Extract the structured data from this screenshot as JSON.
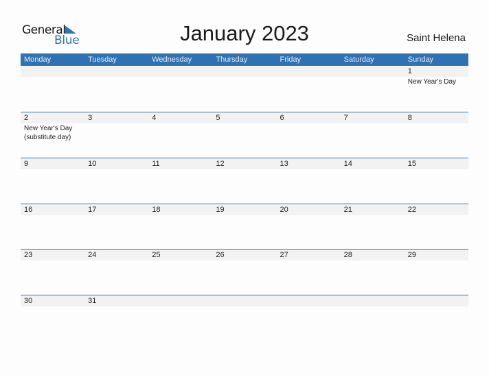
{
  "logo": {
    "line1": "General",
    "line2": "Blue"
  },
  "title": "January 2023",
  "region": "Saint Helena",
  "colors": {
    "accent": "#2e72b3",
    "date_strip": "#f2f2f2",
    "logo_blue": "#2a76c0"
  },
  "weekdays": [
    "Monday",
    "Tuesday",
    "Wednesday",
    "Thursday",
    "Friday",
    "Saturday",
    "Sunday"
  ],
  "weeks": [
    {
      "days": [
        "",
        "",
        "",
        "",
        "",
        "",
        "1"
      ],
      "events": [
        "",
        "",
        "",
        "",
        "",
        "",
        "New Year's Day"
      ]
    },
    {
      "days": [
        "2",
        "3",
        "4",
        "5",
        "6",
        "7",
        "8"
      ],
      "events": [
        "New Year's Day (substitute day)",
        "",
        "",
        "",
        "",
        "",
        ""
      ]
    },
    {
      "days": [
        "9",
        "10",
        "11",
        "12",
        "13",
        "14",
        "15"
      ],
      "events": [
        "",
        "",
        "",
        "",
        "",
        "",
        ""
      ]
    },
    {
      "days": [
        "16",
        "17",
        "18",
        "19",
        "20",
        "21",
        "22"
      ],
      "events": [
        "",
        "",
        "",
        "",
        "",
        "",
        ""
      ]
    },
    {
      "days": [
        "23",
        "24",
        "25",
        "26",
        "27",
        "28",
        "29"
      ],
      "events": [
        "",
        "",
        "",
        "",
        "",
        "",
        ""
      ]
    },
    {
      "days": [
        "30",
        "31",
        "",
        "",
        "",
        "",
        ""
      ],
      "events": [
        "",
        "",
        "",
        "",
        "",
        "",
        ""
      ]
    }
  ]
}
